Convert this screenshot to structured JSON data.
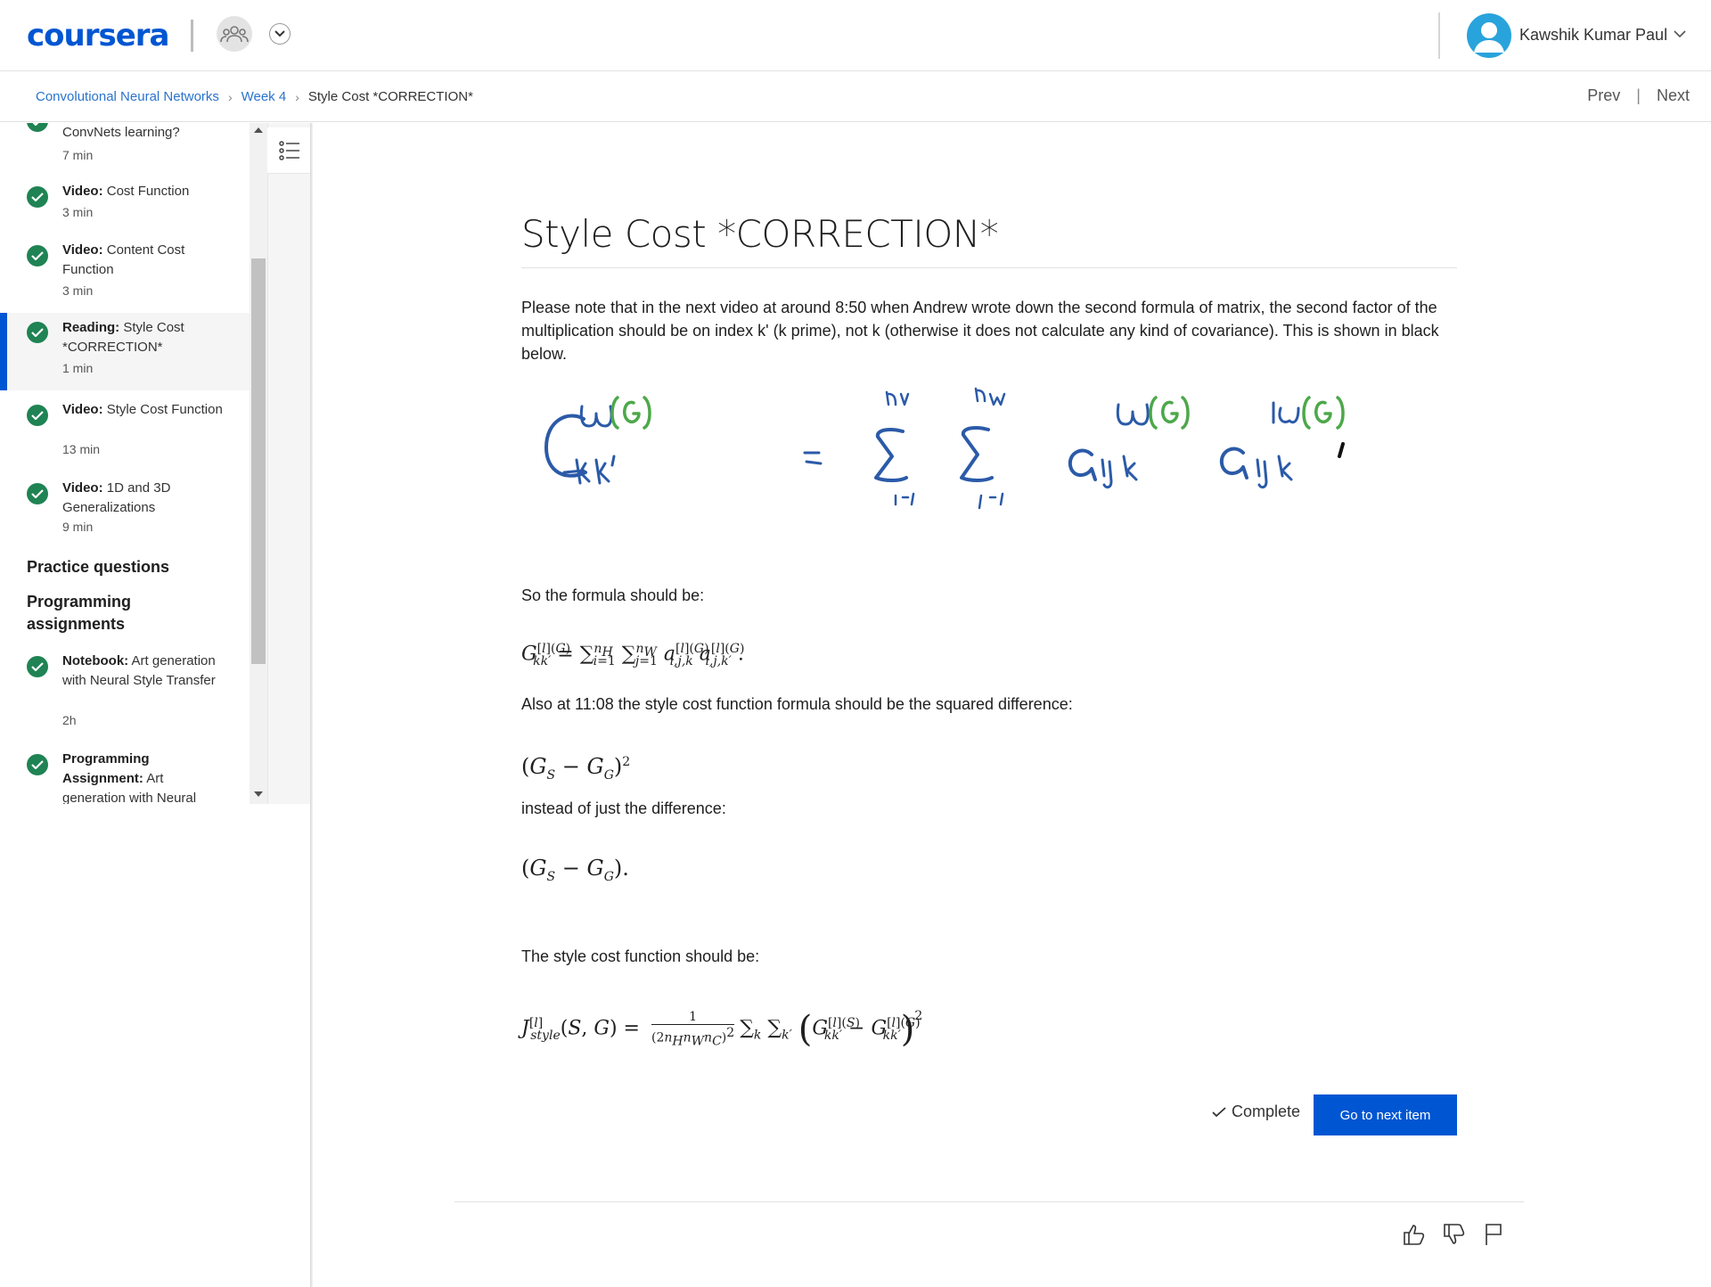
{
  "header": {
    "logo_text": "coursera",
    "user_name": "Kawshik Kumar Paul"
  },
  "breadcrumb": {
    "course": "Convolutional Neural Networks",
    "week": "Week 4",
    "current": "Style Cost *CORRECTION*"
  },
  "nav": {
    "prev": "Prev",
    "next": "Next"
  },
  "sidebar": {
    "items": [
      {
        "type": "",
        "title": "ConvNets learning?",
        "duration": "7 min"
      },
      {
        "type": "Video:",
        "title": "Cost Function",
        "duration": "3 min"
      },
      {
        "type": "Video:",
        "title": "Content Cost Function",
        "duration": "3 min"
      },
      {
        "type": "Reading:",
        "title": "Style Cost *CORRECTION*",
        "duration": "1 min"
      },
      {
        "type": "Video:",
        "title": "Style Cost Function",
        "duration": "13 min"
      },
      {
        "type": "Video:",
        "title": "1D and 3D Generalizations",
        "duration": "9 min"
      }
    ],
    "section_practice": "Practice questions",
    "section_programming": "Programming assignments",
    "prog_items": [
      {
        "type": "Notebook:",
        "title": "Art generation with Neural Style Transfer",
        "duration": "2h"
      },
      {
        "type": "Programming Assignment:",
        "title": "Art generation with Neural",
        "duration": ""
      }
    ]
  },
  "main": {
    "title": "Style Cost *CORRECTION*",
    "intro": "Please note that in the next video at around 8:50 when Andrew wrote down the second formula of matrix, the second factor of the multiplication should be on index k' (k prime), not k (otherwise it does not calculate any kind of covariance). This is shown in black below.",
    "formula_intro": "So the formula should be:",
    "also_text": "Also at 11:08 the style cost function formula should be the squared difference:",
    "instead_text": "instead of just the difference:",
    "style_cost_text": "The style cost function should be:",
    "complete_label": "Complete",
    "next_item_label": "Go to next item"
  },
  "colors": {
    "brand": "#0056d2",
    "check": "#1f8354",
    "link": "#2a73cc"
  }
}
